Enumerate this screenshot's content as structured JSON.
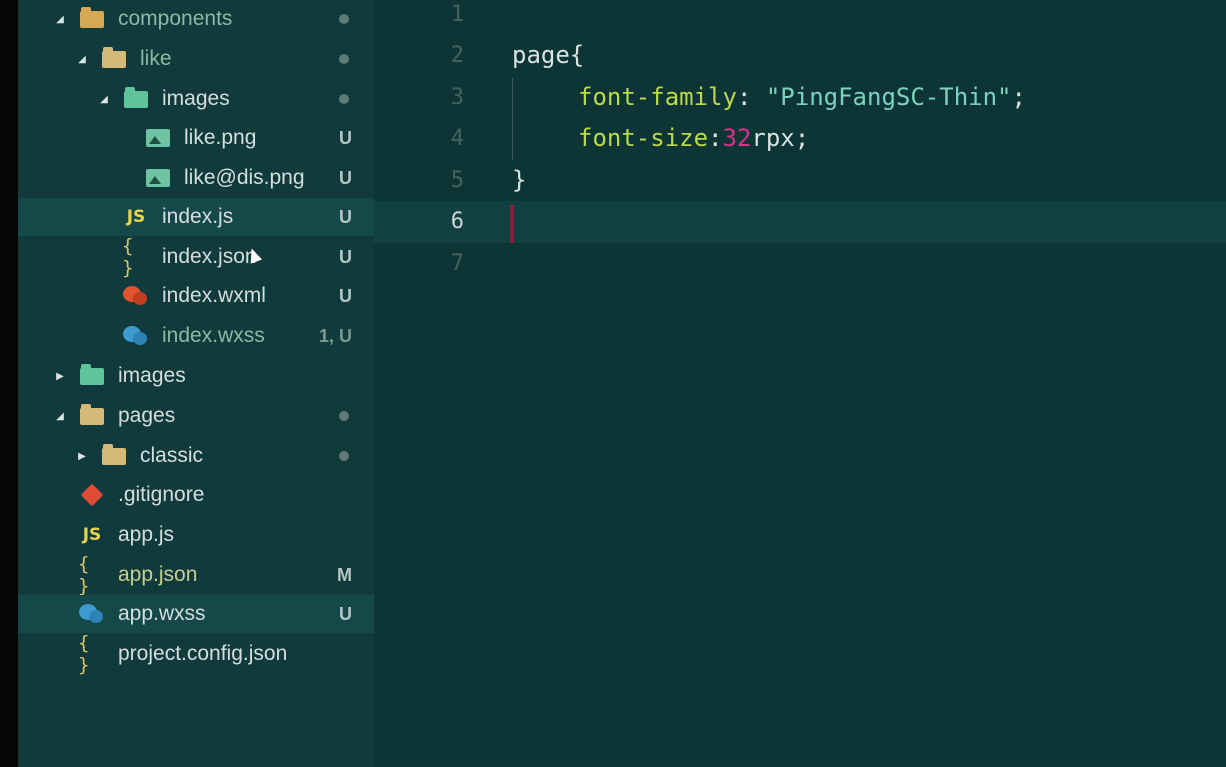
{
  "explorer": {
    "items": [
      {
        "label": "components",
        "kind": "folder-comp",
        "twisty": "open",
        "status": "dot"
      },
      {
        "label": "like",
        "kind": "folder",
        "twisty": "open",
        "status": "dot"
      },
      {
        "label": "images",
        "kind": "folder-img",
        "twisty": "open",
        "status": "dot"
      },
      {
        "label": "like.png",
        "kind": "image",
        "status": "U"
      },
      {
        "label": "like@dis.png",
        "kind": "image",
        "status": "U"
      },
      {
        "label": "index.js",
        "kind": "js",
        "status": "U"
      },
      {
        "label": "index.json",
        "kind": "json",
        "status": "U"
      },
      {
        "label": "index.wxml",
        "kind": "wxml",
        "status": "U"
      },
      {
        "label": "index.wxss",
        "kind": "wxss",
        "status": "1, U"
      },
      {
        "label": "images",
        "kind": "folder-img",
        "twisty": "closed"
      },
      {
        "label": "pages",
        "kind": "folder",
        "twisty": "open",
        "status": "dot"
      },
      {
        "label": "classic",
        "kind": "folder",
        "twisty": "closed",
        "status": "dot"
      },
      {
        "label": ".gitignore",
        "kind": "git"
      },
      {
        "label": "app.js",
        "kind": "js"
      },
      {
        "label": "app.json",
        "kind": "json",
        "status": "M"
      },
      {
        "label": "app.wxss",
        "kind": "wxss",
        "status": "U"
      },
      {
        "label": "project.config.json",
        "kind": "json"
      }
    ],
    "js_icon": "JS",
    "json_icon": "{ }"
  },
  "editor": {
    "line_numbers": [
      "1",
      "2",
      "3",
      "4",
      "5",
      "6",
      "7"
    ],
    "active_line": "6",
    "code": {
      "line2": "page{",
      "line3_prop": "font-family",
      "line3_colon": ": ",
      "line3_string": "\"PingFangSC-Thin\"",
      "line3_end": ";",
      "line4_prop": "font-size",
      "line4_colon": ":",
      "line4_number": "32",
      "line4_unit": "rpx;",
      "line5": "}"
    }
  },
  "colors": {
    "background": "#0f3b3b",
    "selected_row": "#154848",
    "property": "#bcd84d",
    "string": "#7cd2c1",
    "number": "#d3338d"
  }
}
